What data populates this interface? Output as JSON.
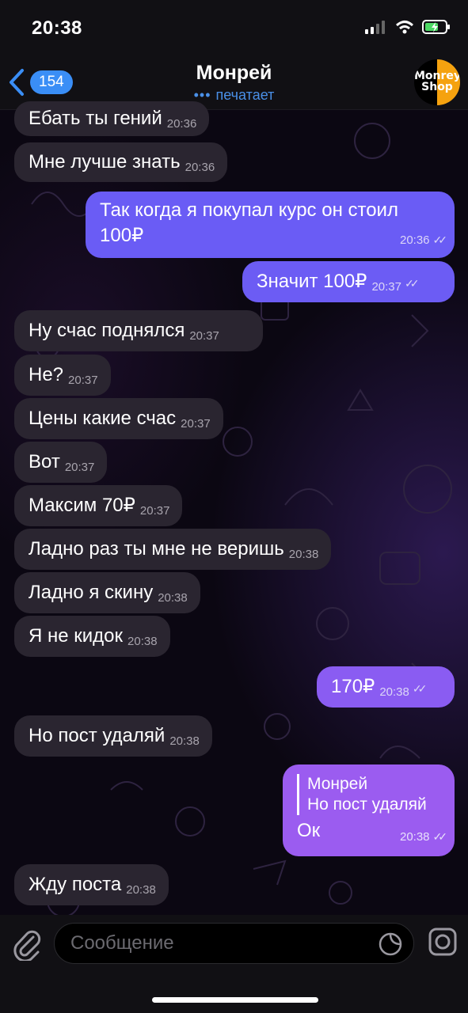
{
  "status": {
    "time": "20:38"
  },
  "header": {
    "back_count": "154",
    "title": "Монрей",
    "subtitle": "печатает",
    "avatar_text_line1": "Monrey",
    "avatar_text_line2": "Shop"
  },
  "messages": [
    {
      "dir": "in",
      "text": "Ебать ты гений",
      "time": "20:36"
    },
    {
      "dir": "in",
      "text": "Мне лучше знать",
      "time": "20:36"
    },
    {
      "dir": "out",
      "text_line1": "Так когда я покупал курс он стоил",
      "text_line2": "100₽",
      "time": "20:36"
    },
    {
      "dir": "out",
      "text": "Значит 100₽",
      "time": "20:37"
    },
    {
      "dir": "in",
      "text": "Ну счас поднялся",
      "time": "20:37"
    },
    {
      "dir": "in",
      "text": "Не?",
      "time": "20:37"
    },
    {
      "dir": "in",
      "text": "Цены какие счас",
      "time": "20:37"
    },
    {
      "dir": "in",
      "text": "Вот",
      "time": "20:37"
    },
    {
      "dir": "in",
      "text": "Максим 70₽",
      "time": "20:37"
    },
    {
      "dir": "in",
      "text": "Ладно раз ты мне не веришь",
      "time": "20:38"
    },
    {
      "dir": "in",
      "text": "Ладно я скину",
      "time": "20:38"
    },
    {
      "dir": "in",
      "text": "Я не кидок",
      "time": "20:38"
    },
    {
      "dir": "out",
      "text": "170₽",
      "time": "20:38"
    },
    {
      "dir": "in",
      "text": "Но пост удаляй",
      "time": "20:38"
    },
    {
      "dir": "out",
      "reply_author": "Монрей",
      "reply_text": "Но пост удаляй",
      "text": "Ок",
      "time": "20:38"
    },
    {
      "dir": "in",
      "text": "Жду поста",
      "time": "20:38"
    }
  ],
  "input": {
    "placeholder": "Сообщение"
  },
  "icons": {
    "back": "chevron-left-icon",
    "attach": "paperclip-icon",
    "sticker": "sticker-icon",
    "camera": "camera-icon",
    "read": "double-check-icon"
  },
  "colors": {
    "accent": "#3a8ef6",
    "incoming_bubble": "#2a2530",
    "outgoing_top": "#6a5cf5",
    "outgoing_bottom": "#9b5cf0"
  }
}
